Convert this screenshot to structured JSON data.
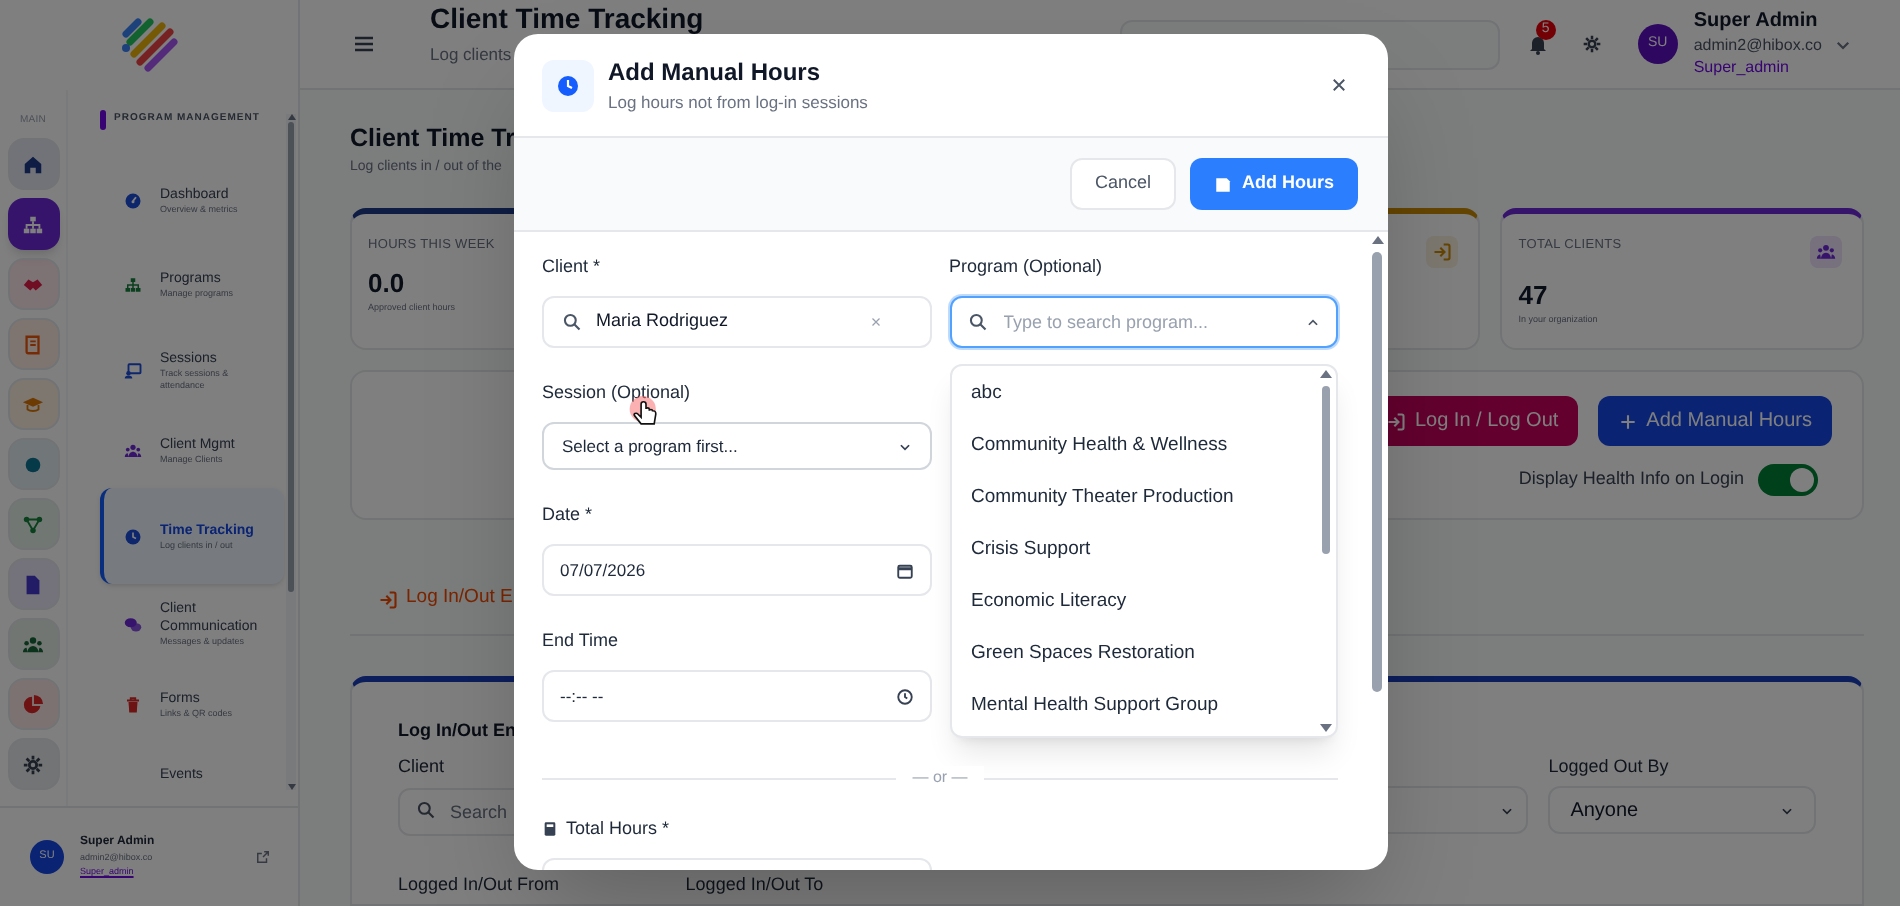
{
  "sidebar": {
    "rail_label": "MAIN",
    "rail": [
      {
        "kind": "home",
        "selected": false
      },
      {
        "kind": "org",
        "selected": true
      },
      {
        "kind": "handshake",
        "selected": false
      },
      {
        "kind": "book",
        "selected": false
      },
      {
        "kind": "cap",
        "selected": false
      },
      {
        "kind": "dot",
        "selected": false
      },
      {
        "kind": "network",
        "selected": false
      },
      {
        "kind": "doc",
        "selected": false
      },
      {
        "kind": "people",
        "selected": false
      },
      {
        "kind": "pie",
        "selected": false
      },
      {
        "kind": "gear",
        "selected": false
      }
    ],
    "section": "PROGRAM MANAGEMENT",
    "nav": [
      {
        "kind": "dashboard",
        "label": "Dashboard",
        "sublabel": "Overview & metrics",
        "selected": false
      },
      {
        "kind": "programs",
        "label": "Programs",
        "sublabel": "Manage programs",
        "selected": false
      },
      {
        "kind": "sessions",
        "label": "Sessions",
        "sublabel": "Track sessions & attendance",
        "selected": false
      },
      {
        "kind": "clients",
        "label": "Client Mgmt",
        "sublabel": "Manage Clients",
        "selected": false
      },
      {
        "kind": "time",
        "label": "Time Tracking",
        "sublabel": "Log clients in / out",
        "selected": true
      },
      {
        "kind": "communication",
        "label": "Client Communication",
        "sublabel": "Messages & updates",
        "selected": false
      },
      {
        "kind": "forms",
        "label": "Forms",
        "sublabel": "Links & QR codes",
        "selected": false
      },
      {
        "kind": "events",
        "label": "Events",
        "selected": false
      }
    ],
    "user": {
      "initials": "SU",
      "name": "Super Admin",
      "email": "admin2@hibox.co",
      "role": "Super_admin"
    }
  },
  "header": {
    "title": "Client Time Tracking",
    "subtitle": "Log clients",
    "notification_count": "5",
    "user": {
      "initials": "SU",
      "name": "Super Admin",
      "email": "admin2@hibox.co",
      "role": "Super_admin"
    }
  },
  "page": {
    "title": "Client Time Tr",
    "subtitle": "Log clients in / out of the",
    "stats": [
      {
        "kind": "hours",
        "label": "HOURS THIS WEEK",
        "value": "0.0",
        "caption": "Approved client hours"
      },
      {
        "kind": "logins"
      },
      {
        "kind": "clients",
        "label": "TOTAL CLIENTS",
        "value": "47",
        "caption": "In your organization"
      }
    ],
    "actions": [
      {
        "kind": "login",
        "label": "Log In / Log Out"
      },
      {
        "kind": "add",
        "label": "Add Manual Hours"
      }
    ],
    "toggle": {
      "label": "Display Health Info on Login",
      "on": true
    },
    "tabs": [
      {
        "label": "Log In/Out E",
        "selected": true
      }
    ],
    "filters": {
      "title": "Log In/Out En",
      "client": {
        "label": "Client",
        "placeholder": "Search"
      },
      "logged_out_by": {
        "label": "Logged Out By",
        "value": "Anyone"
      },
      "from_label": "Logged In/Out From",
      "to_label": "Logged In/Out To"
    }
  },
  "modal": {
    "title": "Add Manual Hours",
    "subtitle": "Log hours not from log-in sessions",
    "buttons": [
      {
        "kind": "secondary",
        "label": "Cancel"
      },
      {
        "kind": "primary",
        "label": "Add Hours"
      }
    ],
    "client": {
      "label": "Client *",
      "value": "Maria Rodriguez"
    },
    "program": {
      "label": "Program (Optional)",
      "placeholder": "Type to search program...",
      "expanded": true,
      "options": [
        {
          "label": "abc",
          "selected": false
        },
        {
          "label": "Community Health & Wellness",
          "selected": false
        },
        {
          "label": "Community Theater Production",
          "selected": false
        },
        {
          "label": "Crisis Support",
          "selected": false
        },
        {
          "label": "Economic Literacy",
          "selected": false
        },
        {
          "label": "Green Spaces Restoration",
          "selected": false
        },
        {
          "label": "Mental Health Support Group",
          "selected": false
        }
      ]
    },
    "session": {
      "label": "Session (Optional)",
      "value": "Select a program first..."
    },
    "date": {
      "label": "Date *",
      "value": "07/07/2026"
    },
    "end_time": {
      "label": "End Time",
      "value": "--:-- --"
    },
    "divider": "— or —",
    "total_hours": {
      "label": "Total Hours *"
    }
  }
}
